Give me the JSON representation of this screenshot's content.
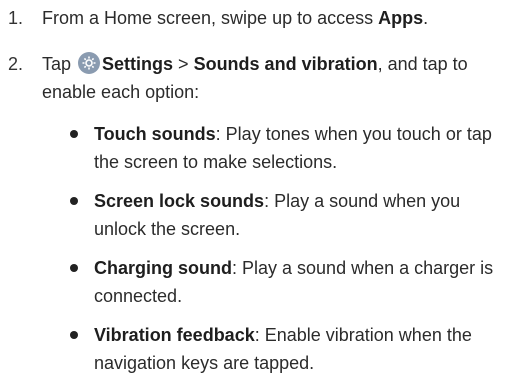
{
  "steps": [
    {
      "number": "1.",
      "pre": "From a Home screen, swipe up to access ",
      "bold": "Apps",
      "post": "."
    },
    {
      "number": "2.",
      "pre": "Tap ",
      "icon": "settings-gear-icon",
      "bold1": "Settings",
      "sep": " > ",
      "bold2": "Sounds and vibration",
      "post": ", and tap to enable each option:"
    }
  ],
  "options": [
    {
      "title": "Touch sounds",
      "desc": ": Play tones when you touch or tap the screen to make selections."
    },
    {
      "title": "Screen lock sounds",
      "desc": ": Play a sound when you unlock the screen."
    },
    {
      "title": "Charging sound",
      "desc": ": Play a sound when a charger is connected."
    },
    {
      "title": "Vibration feedback",
      "desc": ": Enable vibration when the navigation keys are tapped."
    }
  ],
  "colors": {
    "icon_bg": "#8a9bb0",
    "text": "#2b2b2b"
  }
}
